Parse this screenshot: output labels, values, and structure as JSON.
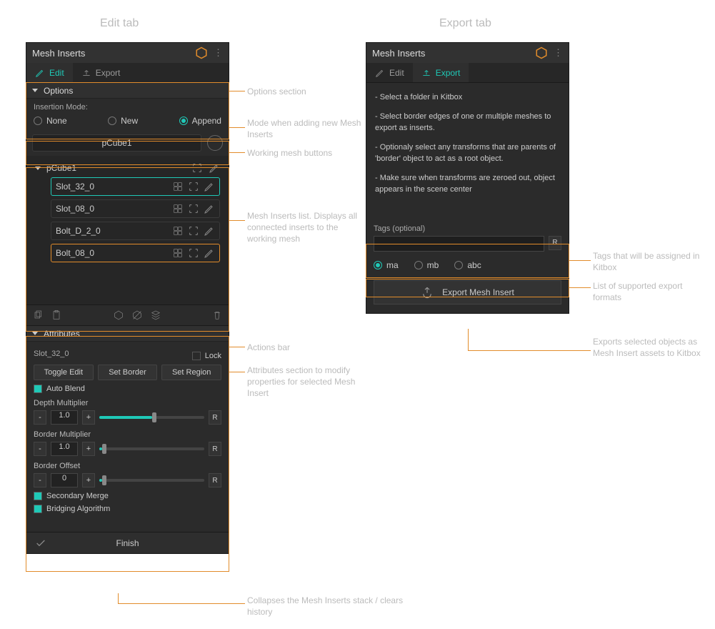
{
  "page_titles": {
    "left": "Edit tab",
    "right": "Export tab"
  },
  "panel": {
    "title": "Mesh Inserts",
    "tabs": {
      "edit": "Edit",
      "export": "Export"
    }
  },
  "edit": {
    "options": {
      "header": "Options",
      "mode_label": "Insertion Mode:",
      "modes": {
        "none": "None",
        "new": "New",
        "append": "Append"
      },
      "selected": "append"
    },
    "working_mesh": "pCube1",
    "list": {
      "header": "pCube1",
      "items": [
        {
          "name": "Slot_32_0",
          "highlight": "teal"
        },
        {
          "name": "Slot_08_0",
          "highlight": ""
        },
        {
          "name": "Bolt_D_2_0",
          "highlight": ""
        },
        {
          "name": "Bolt_08_0",
          "highlight": "orange"
        }
      ]
    },
    "attributes": {
      "header": "Attributes",
      "target": "Slot_32_0",
      "lock_label": "Lock",
      "buttons": {
        "toggle": "Toggle Edit",
        "border": "Set Border",
        "region": "Set Region"
      },
      "auto_blend": "Auto Blend",
      "sliders": {
        "depth": {
          "label": "Depth Multiplier",
          "value": "1.0",
          "fill": 50,
          "reset": "R"
        },
        "border": {
          "label": "Border Multiplier",
          "value": "1.0",
          "fill": 2,
          "reset": "R"
        },
        "offset": {
          "label": "Border Offset",
          "value": "0",
          "fill": 2,
          "reset": "R"
        }
      },
      "secondary_merge": "Secondary Merge",
      "bridging": "Bridging Algorithm"
    },
    "finish": "Finish"
  },
  "export": {
    "instructions": [
      "- Select a folder in Kitbox",
      "- Select border edges of one or multiple meshes to export as inserts.",
      "- Optionaly select any transforms that are parents of 'border' object to act as a root object.",
      "- Make sure when transforms are zeroed out, object appears in the scene center"
    ],
    "tags_label": "Tags (optional)",
    "tags_reset": "R",
    "formats": {
      "ma": "ma",
      "mb": "mb",
      "abc": "abc",
      "selected": "ma"
    },
    "button": "Export Mesh Insert"
  },
  "annotations": {
    "options": "Options section",
    "mode": "Mode when adding new Mesh Inserts",
    "working": "Working mesh buttons",
    "list": "Mesh Inserts list. Displays all connected inserts to the working mesh",
    "actions": "Actions bar",
    "attributes": "Attributes section to modify properties for selected Mesh Insert",
    "finish": "Collapses the Mesh Inserts stack / clears history",
    "tags": "Tags that will be assigned in Kitbox",
    "formats": "List of supported export formats",
    "export_btn": "Exports selected objects as Mesh Insert assets to Kitbox"
  }
}
